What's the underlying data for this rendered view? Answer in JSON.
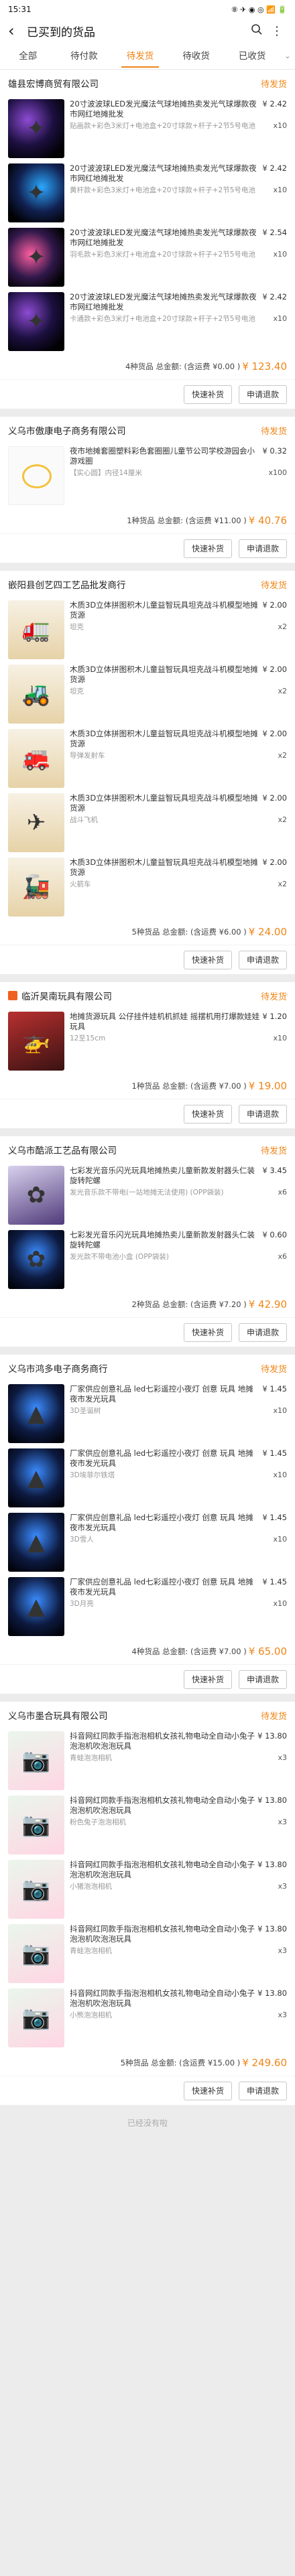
{
  "status_bar": {
    "time": "15:31",
    "right_icons": "⑧ ✈ ◉ ◎ 📶 🔋"
  },
  "header": {
    "back_glyph": "‹",
    "title": "已买到的货品",
    "search_glyph": "○",
    "more_glyph": "⋮"
  },
  "tabs": [
    {
      "label": "全部"
    },
    {
      "label": "待付款"
    },
    {
      "label": "待发货"
    },
    {
      "label": "待收货"
    },
    {
      "label": "已收货"
    }
  ],
  "tabs_more_glyph": "⌄",
  "watermark": "@1688",
  "footer": "已经没有啦",
  "orders": [
    {
      "shop": "雄县宏博商贸有限公司",
      "status": "待发货",
      "items": [
        {
          "icon": "led-balloon",
          "glyph": "✦",
          "name": "20寸波波球LED发光魔法气球地摊热卖发光气球爆款夜市网红地摊批发",
          "price": "¥ 2.42",
          "spec": "贴画款+彩色3米灯+电池盒+20寸球款+杆子+2节5号电池",
          "qty": "x10"
        },
        {
          "icon": "led-balloon",
          "glyph": "✦",
          "name": "20寸波波球LED发光魔法气球地摊热卖发光气球爆款夜市网红地摊批发",
          "price": "¥ 2.42",
          "spec": "黄杆款+彩色3米灯+电池盒+20寸球款+杆子+2节5号电池",
          "qty": "x10"
        },
        {
          "icon": "led-balloon",
          "glyph": "✦",
          "name": "20寸波波球LED发光魔法气球地摊热卖发光气球爆款夜市网红地摊批发",
          "price": "¥ 2.54",
          "spec": "羽毛款+彩色3米灯+电池盒+20寸球款+杆子+2节5号电池",
          "qty": "x10"
        },
        {
          "icon": "led-balloon",
          "glyph": "✦",
          "name": "20寸波波球LED发光魔法气球地摊热卖发光气球爆款夜市网红地摊批发",
          "price": "¥ 2.42",
          "spec": "卡通款+彩色3米灯+电池盒+20寸球款+杆子+2节5号电池",
          "qty": "x10"
        }
      ],
      "summary": "4种货品 总金额: (含运费 ¥0.00 )",
      "total": "¥ 123.40",
      "buttons": [
        "快速补货",
        "申请退款"
      ]
    },
    {
      "shop": "义乌市傲康电子商务有限公司",
      "status": "待发货",
      "items": [
        {
          "icon": "ring-toy",
          "glyph": "",
          "name": "夜市地摊套圈塑料彩色套圈圈儿童节公司学校游园会小游戏圈",
          "price": "¥ 0.32",
          "spec": "【实心圆】内径14厘米",
          "qty": "x100"
        }
      ],
      "summary": "1种货品 总金额: (含运费 ¥11.00 )",
      "total": "¥ 40.76",
      "buttons": [
        "快速补货",
        "申请退款"
      ]
    },
    {
      "shop": "嵌阳县创艺四工艺品批发商行",
      "status": "待发货",
      "items": [
        {
          "icon": "wood-model",
          "glyph": "🚛",
          "name": "木质3D立体拼图积木儿童益智玩具坦克战斗机模型地摊货源",
          "price": "¥ 2.00",
          "spec": "坦克",
          "qty": "x2"
        },
        {
          "icon": "wood-model",
          "glyph": "🚜",
          "name": "木质3D立体拼图积木儿童益智玩具坦克战斗机模型地摊货源",
          "price": "¥ 2.00",
          "spec": "坦克",
          "qty": "x2"
        },
        {
          "icon": "wood-model",
          "glyph": "🚒",
          "name": "木质3D立体拼图积木儿童益智玩具坦克战斗机模型地摊货源",
          "price": "¥ 2.00",
          "spec": "导弹发射车",
          "qty": "x2"
        },
        {
          "icon": "wood-model",
          "glyph": "✈",
          "name": "木质3D立体拼图积木儿童益智玩具坦克战斗机模型地摊货源",
          "price": "¥ 2.00",
          "spec": "战斗飞机",
          "qty": "x2"
        },
        {
          "icon": "wood-model",
          "glyph": "🚂",
          "name": "木质3D立体拼图积木儿童益智玩具坦克战斗机模型地摊货源",
          "price": "¥ 2.00",
          "spec": "火箭车",
          "qty": "x2"
        }
      ],
      "summary": "5种货品 总金额: (含运费 ¥6.00 )",
      "total": "¥ 24.00",
      "buttons": [
        "快速补货",
        "申请退款"
      ]
    },
    {
      "shop": "临沂昊南玩具有限公司",
      "status": "待发货",
      "items": [
        {
          "icon": "drone-toy",
          "glyph": "🚁",
          "name": "地摊货源玩具 公仔挂件娃机机抓娃 摇摆机用打爆款娃娃玩具",
          "price": "¥ 1.20",
          "spec": "12至15cm",
          "qty": "x10"
        }
      ],
      "summary": "1种货品 总金额: (含运费 ¥7.00 )",
      "total": "¥ 19.00",
      "buttons": [
        "快速补货",
        "申请退款"
      ]
    },
    {
      "shop": "义乌市酷派工艺品有限公司",
      "status": "待发货",
      "items": [
        {
          "icon": "lotus-lamp",
          "glyph": "✿",
          "name": "七彩发光音乐闪光玩具地摊热卖儿童新款发射器头仁装旋转陀螺",
          "price": "¥ 3.45",
          "spec": "发光音乐款不带电(一站地摊无法使用) (OPP袋装)",
          "qty": "x6"
        },
        {
          "icon": "lotus-lamp",
          "glyph": "✿",
          "name": "七彩发光音乐闪光玩具地摊热卖儿童新款发射器头仁装旋转陀螺",
          "price": "¥ 0.60",
          "spec": "发光款不带电池小盒 (OPP袋装)",
          "qty": "x6"
        }
      ],
      "summary": "2种货品 总金额: (含运费 ¥7.20 )",
      "total": "¥ 42.90",
      "buttons": [
        "快速补货",
        "申请退款"
      ]
    },
    {
      "shop": "义乌市鸿多电子商务商行",
      "status": "待发货",
      "items": [
        {
          "icon": "tower-lamp",
          "glyph": "▲",
          "name": "厂家供应创意礼品 led七彩遥控小夜灯 创意 玩具 地摊夜市发光玩具",
          "price": "¥ 1.45",
          "spec": "3D圣诞树",
          "qty": "x10"
        },
        {
          "icon": "tower-lamp",
          "glyph": "▲",
          "name": "厂家供应创意礼品 led七彩遥控小夜灯 创意 玩具 地摊夜市发光玩具",
          "price": "¥ 1.45",
          "spec": "3D埃菲尔铁塔",
          "qty": "x10"
        },
        {
          "icon": "tower-lamp",
          "glyph": "▲",
          "name": "厂家供应创意礼品 led七彩遥控小夜灯 创意 玩具 地摊夜市发光玩具",
          "price": "¥ 1.45",
          "spec": "3D雪人",
          "qty": "x10"
        },
        {
          "icon": "tower-lamp",
          "glyph": "▲",
          "name": "厂家供应创意礼品 led七彩遥控小夜灯 创意 玩具 地摊夜市发光玩具",
          "price": "¥ 1.45",
          "spec": "3D月亮",
          "qty": "x10"
        }
      ],
      "summary": "4种货品 总金额: (含运费 ¥7.00 )",
      "total": "¥ 65.00",
      "buttons": [
        "快速补货",
        "申请退款"
      ]
    },
    {
      "shop": "义乌市墨合玩具有限公司",
      "status": "待发货",
      "items": [
        {
          "icon": "bubble-camera",
          "glyph": "📷",
          "name": "抖音网红同款手指泡泡相机女孩礼物电动全自动小兔子泡泡机吹泡泡玩具",
          "price": "¥ 13.80",
          "spec": "青蛙泡泡相机",
          "qty": "x3"
        },
        {
          "icon": "bubble-camera",
          "glyph": "📷",
          "name": "抖音网红同款手指泡泡相机女孩礼物电动全自动小兔子泡泡机吹泡泡玩具",
          "price": "¥ 13.80",
          "spec": "粉色兔子泡泡相机",
          "qty": "x3"
        },
        {
          "icon": "bubble-camera",
          "glyph": "📷",
          "name": "抖音网红同款手指泡泡相机女孩礼物电动全自动小兔子泡泡机吹泡泡玩具",
          "price": "¥ 13.80",
          "spec": "小猪泡泡相机",
          "qty": "x3"
        },
        {
          "icon": "bubble-camera",
          "glyph": "📷",
          "name": "抖音网红同款手指泡泡相机女孩礼物电动全自动小兔子泡泡机吹泡泡玩具",
          "price": "¥ 13.80",
          "spec": "青蛙泡泡相机",
          "qty": "x3"
        },
        {
          "icon": "bubble-camera",
          "glyph": "📷",
          "name": "抖音网红同款手指泡泡相机女孩礼物电动全自动小兔子泡泡机吹泡泡玩具",
          "price": "¥ 13.80",
          "spec": "小熊泡泡相机",
          "qty": "x3"
        }
      ],
      "summary": "5种货品 总金额: (含运费 ¥15.00 )",
      "total": "¥ 249.60",
      "buttons": [
        "快速补货",
        "申请退款"
      ]
    }
  ]
}
